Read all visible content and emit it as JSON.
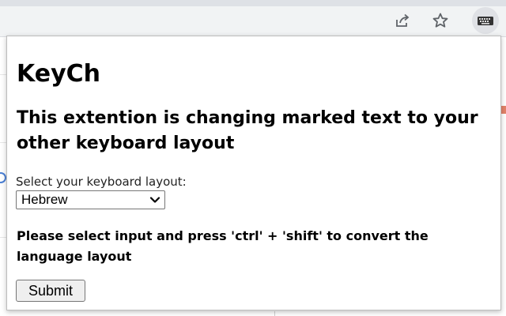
{
  "popup": {
    "title": "KeyCh",
    "subtitle": "This extention is changing marked text to your other keyboard layout",
    "select_label": "Select your keyboard layout:",
    "selected_layout": "Hebrew",
    "instructions": "Please select input and press 'ctrl' + 'shift' to convert the language layout",
    "submit_label": "Submit"
  },
  "toolbar": {
    "icons": [
      "share-icon",
      "star-icon",
      "keyboard-extension-icon"
    ]
  },
  "colors": {
    "toolbar_bg": "#f1f3f4",
    "popup_border": "#bdbdbd",
    "button_bg": "#efefef"
  }
}
